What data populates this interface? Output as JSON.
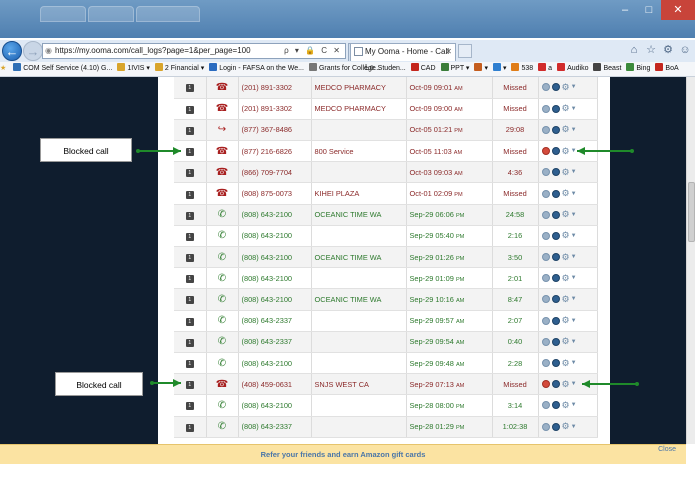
{
  "browser": {
    "url": "https://my.ooma.com/call_logs?page=1&per_page=100",
    "active_tab_title": "My Ooma - Home - Call Lo...",
    "address_tools": "ρ ▾ 🔒 C ✕"
  },
  "favorites": [
    {
      "label": "COM Self Service (4.10) G...",
      "color": "#2f6fb5"
    },
    {
      "label": "1IVIS ▾",
      "color": "#d9a52c"
    },
    {
      "label": "2 Financial ▾",
      "color": "#d9a52c"
    },
    {
      "label": "Login - FAFSA on the We...",
      "color": "#2a6bc0"
    },
    {
      "label": "Grants for College Studen...",
      "color": "#777777"
    },
    {
      "label": "CAD",
      "color": "#c4261d"
    },
    {
      "label": "PPT ▾",
      "color": "#3a7d3a"
    },
    {
      "label": "▾",
      "color": "#c45d1e"
    },
    {
      "label": "▾",
      "color": "#2f7fd0"
    },
    {
      "label": "538",
      "color": "#e07d18"
    },
    {
      "label": "a",
      "color": "#d12b2b"
    },
    {
      "label": "Audiko",
      "color": "#d12b2b"
    },
    {
      "label": "Beast",
      "color": "#444444"
    },
    {
      "label": "Bing",
      "color": "#3b8a3b"
    },
    {
      "label": "BoA",
      "color": "#c4261d"
    }
  ],
  "call_log": {
    "rows": [
      {
        "type": "missed",
        "number": "(201) 891-3302",
        "name": "MEDCO PHARMACY",
        "date": "Oct-09 09:01",
        "ampm": "AM",
        "duration": "Missed",
        "flag": false
      },
      {
        "type": "missed",
        "number": "(201) 891-3302",
        "name": "MEDCO PHARMACY",
        "date": "Oct-09 09:00",
        "ampm": "AM",
        "duration": "Missed",
        "flag": false
      },
      {
        "type": "outgoing",
        "number": "(877) 367-8486",
        "name": "",
        "date": "Oct-05 01:21",
        "ampm": "PM",
        "duration": "29:08",
        "flag": false
      },
      {
        "type": "blocked",
        "number": "(877) 216-6826",
        "name": "800 Service",
        "date": "Oct-05 11:03",
        "ampm": "AM",
        "duration": "Missed",
        "flag": true
      },
      {
        "type": "missed",
        "number": "(866) 709-7704",
        "name": "",
        "date": "Oct-03 09:03",
        "ampm": "AM",
        "duration": "4:36",
        "flag": false
      },
      {
        "type": "missed",
        "number": "(808) 875-0073",
        "name": "KIHEI PLAZA",
        "date": "Oct-01 02:09",
        "ampm": "PM",
        "duration": "Missed",
        "flag": false
      },
      {
        "type": "incoming",
        "number": "(808) 643-2100",
        "name": "OCEANIC TIME WA",
        "date": "Sep-29 06:06",
        "ampm": "PM",
        "duration": "24:58",
        "flag": false
      },
      {
        "type": "incoming",
        "number": "(808) 643-2100",
        "name": "",
        "date": "Sep-29 05:40",
        "ampm": "PM",
        "duration": "2:16",
        "flag": false
      },
      {
        "type": "incoming",
        "number": "(808) 643-2100",
        "name": "OCEANIC TIME WA",
        "date": "Sep-29 01:26",
        "ampm": "PM",
        "duration": "3:50",
        "flag": false
      },
      {
        "type": "incoming",
        "number": "(808) 643-2100",
        "name": "",
        "date": "Sep-29 01:09",
        "ampm": "PM",
        "duration": "2:01",
        "flag": false
      },
      {
        "type": "incoming",
        "number": "(808) 643-2100",
        "name": "OCEANIC TIME WA",
        "date": "Sep-29 10:16",
        "ampm": "AM",
        "duration": "8:47",
        "flag": false
      },
      {
        "type": "incoming",
        "number": "(808) 643-2337",
        "name": "",
        "date": "Sep-29 09:57",
        "ampm": "AM",
        "duration": "2:07",
        "flag": false
      },
      {
        "type": "incoming",
        "number": "(808) 643-2337",
        "name": "",
        "date": "Sep-29 09:54",
        "ampm": "AM",
        "duration": "0:40",
        "flag": false
      },
      {
        "type": "incoming",
        "number": "(808) 643-2100",
        "name": "",
        "date": "Sep-29 09:48",
        "ampm": "AM",
        "duration": "2:28",
        "flag": false
      },
      {
        "type": "blocked",
        "number": "(408) 459-0631",
        "name": "SNJS WEST CA",
        "date": "Sep-29 07:13",
        "ampm": "AM",
        "duration": "Missed",
        "flag": true
      },
      {
        "type": "incoming",
        "number": "(808) 643-2100",
        "name": "",
        "date": "Sep-28 08:00",
        "ampm": "PM",
        "duration": "3:14",
        "flag": false
      },
      {
        "type": "incoming",
        "number": "(808) 643-2337",
        "name": "",
        "date": "Sep-28 01:29",
        "ampm": "PM",
        "duration": "1:02:38",
        "flag": false
      }
    ]
  },
  "annotations": {
    "callout_1": "Blocked call",
    "callout_2": "Blocked call",
    "arrow_color": "#1f8a2a"
  },
  "banner": {
    "text": "Refer your friends and earn Amazon gift cards",
    "close": "Close"
  },
  "colors": {
    "dark_background": "#0f1d2e",
    "banner": "#fbe3a2",
    "missed_text": "#8b2a2a",
    "incoming_text": "#2e7a2e"
  }
}
